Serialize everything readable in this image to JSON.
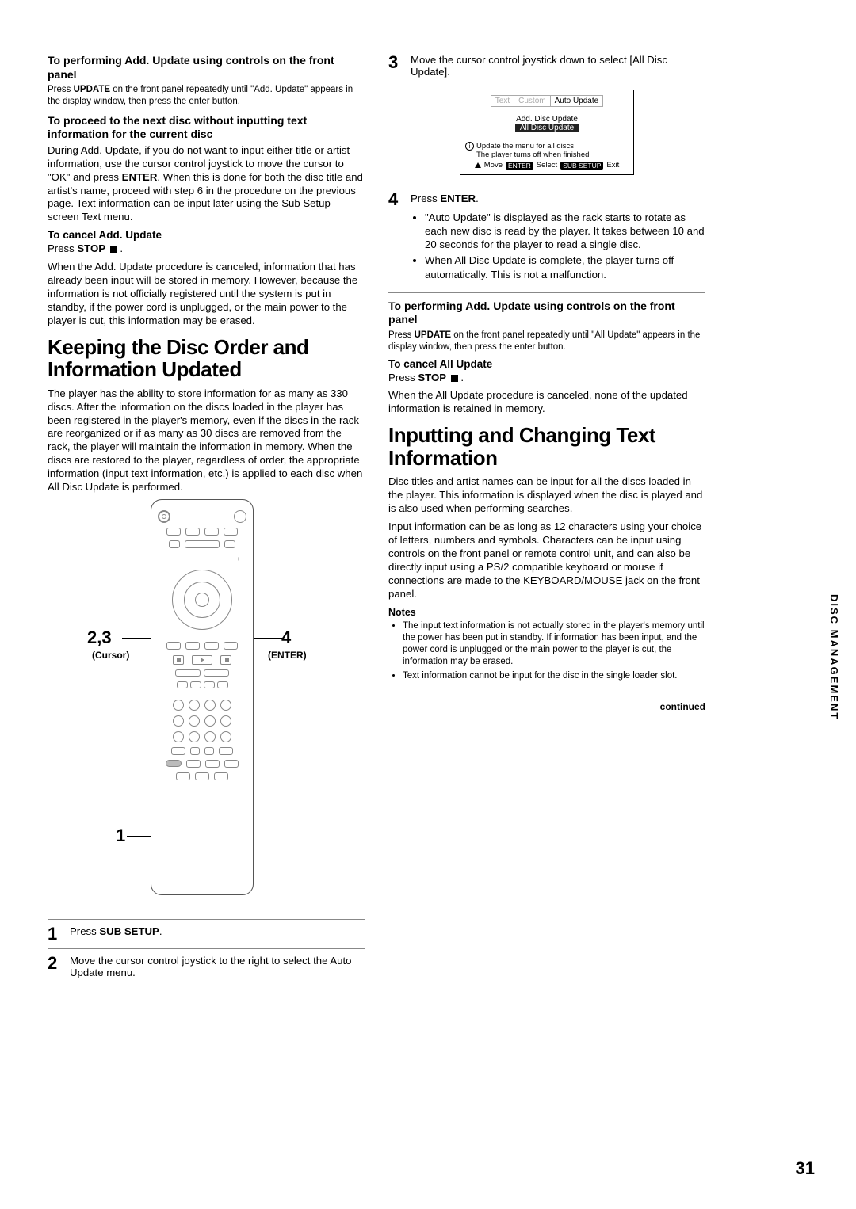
{
  "left": {
    "h3a": "To performing Add. Update using controls on the front panel",
    "p1a": "Press ",
    "p1b": "UPDATE",
    "p1c": " on the front panel repeatedly until \"Add. Update\" appears in the display window, then press the enter button.",
    "h3b": "To proceed to the next disc without inputting text information for the current disc",
    "p2a": "During Add. Update, if you do not want to input either title or artist information, use the cursor control joystick to move the cursor to \"OK\" and press ",
    "p2b": "ENTER",
    "p2c": ". When this is done for both the disc title and artist's name, proceed with step 6 in the procedure on the previous page. Text information can be input later using the Sub Setup screen Text menu.",
    "h4c": "To cancel Add. Update",
    "p3a": "Press ",
    "p3b": "STOP",
    "p3c": " .",
    "p4": "When the Add. Update procedure is canceled, information that has already been input will be stored in memory. However, because the information is not officially registered until the system is put in standby, if the power cord is unplugged, or the main power to the player is cut, this information may be erased.",
    "title1": "Keeping the Disc Order and Information Updated",
    "p5": "The player has the ability to store information for as many as 330 discs. After the information on the discs loaded in the player has been registered in the player's memory, even if the discs in the rack are reorganized or if as many as 30 discs are removed from the rack, the player will maintain the information in memory. When the discs are restored to the player, regardless of order, the appropriate information (input text information, etc.) is applied to each disc when All Disc Update is performed.",
    "remote": {
      "l23": "2,3",
      "cursor": "(Cursor)",
      "l4": "4",
      "enter": "(ENTER)",
      "l1": "1"
    },
    "step1a": "Press ",
    "step1b": "SUB SETUP",
    "step1c": ".",
    "step2": "Move the cursor control joystick to the right to select the Auto Update menu."
  },
  "right": {
    "step3": "Move the cursor control joystick down to select [All Disc Update].",
    "osd": {
      "tab1": "Text",
      "tab2": "Custom",
      "tab3": "Auto Update",
      "line1": "Add. Disc Update",
      "line2": "All Disc Update",
      "info1": "Update the menu for all discs",
      "info2": "The player turns off when finished",
      "move": "Move",
      "enter": "ENTER",
      "select": "Select",
      "subsetup": "SUB SETUP",
      "exit": "Exit"
    },
    "step4a": "Press ",
    "step4b": "ENTER",
    "step4c": ".",
    "b1": "\"Auto Update\" is displayed as the rack starts to rotate as each new disc is read by the player. It takes between 10 and 20 seconds for the player to read a single disc.",
    "b2": "When All Disc Update is complete, the player turns off automatically. This is not a malfunction.",
    "h3d": "To performing Add. Update using controls on the front panel",
    "p6a": "Press ",
    "p6b": "UPDATE",
    "p6c": " on the front panel repeatedly until \"All Update\" appears in the display window, then press the enter button.",
    "h4e": "To cancel All Update",
    "p7a": "Press ",
    "p7b": "STOP",
    "p7c": " .",
    "p8": "When the All Update procedure is canceled, none of the updated information is retained in memory.",
    "title2": "Inputting and Changing Text Information",
    "p9": "Disc titles and artist names can be input for all the discs loaded in the player. This information is displayed when the disc is played and is also used when performing searches.",
    "p10": "Input information can be as long as 12 characters using your choice of letters, numbers and symbols. Characters can be input using controls on the front panel or remote control unit, and can also be directly input using a PS/2 compatible keyboard or mouse if connections are made to the KEYBOARD/MOUSE jack on the front panel.",
    "notes": "Notes",
    "n1": "The input text information is not actually stored in the player's memory until the power has been put in standby. If information has been input, and the power cord is unplugged or the main power to the player is cut, the information may be erased.",
    "n2": "Text information cannot be input for the disc in the single loader slot.",
    "continued": "continued"
  },
  "sidetab": "DISC MANAGEMENT",
  "pagenum": "31"
}
